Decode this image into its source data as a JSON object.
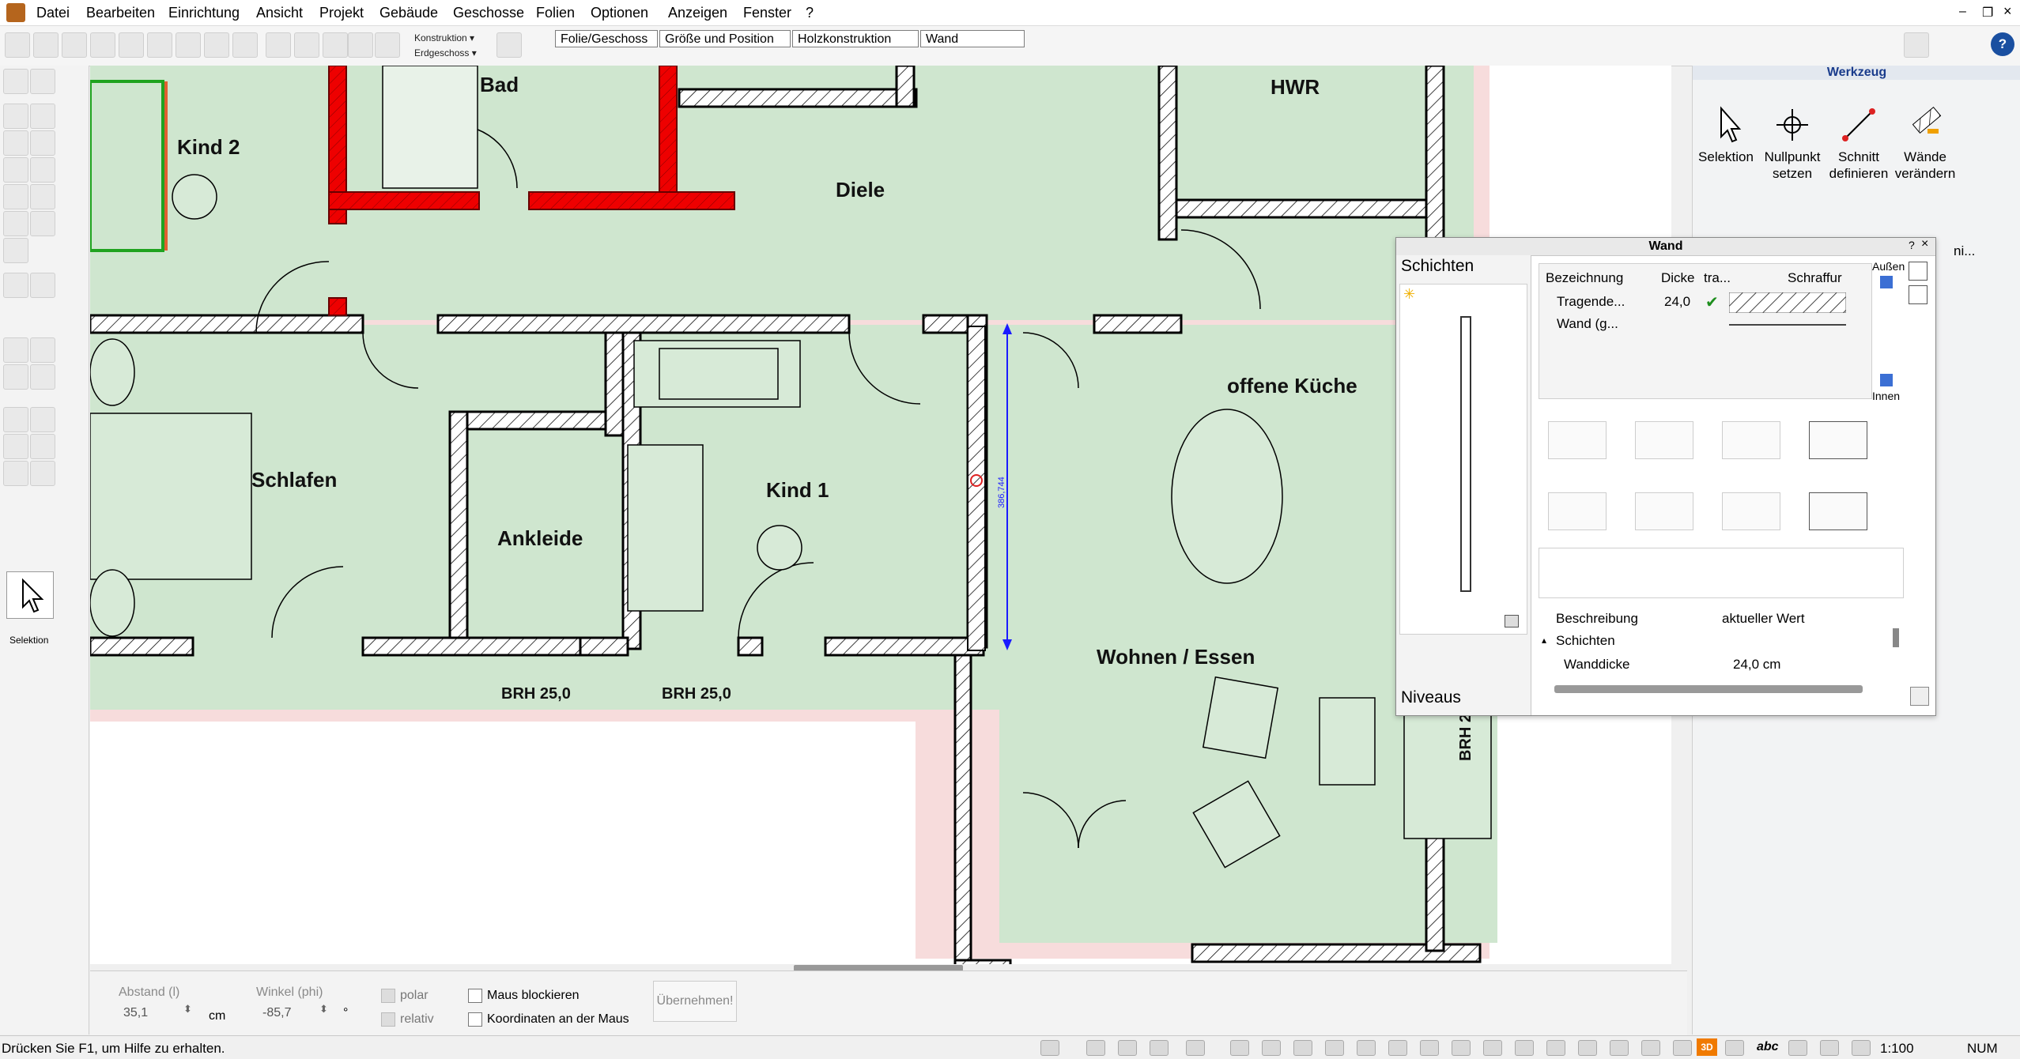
{
  "menu": [
    "Datei",
    "Bearbeiten",
    "Einrichtung",
    "Ansicht",
    "Projekt",
    "Gebäude",
    "Geschosse",
    "Folien",
    "Optionen",
    "Anzeigen",
    "Fenster",
    "?"
  ],
  "toolbar": {
    "konstruktion_label": "Konstruktion ▾",
    "erdgeschoss_label": "Erdgeschoss ▾",
    "fields": [
      "Folie/Geschoss",
      "Größe und Position",
      "Holzkonstruktion",
      "Wand"
    ]
  },
  "left_tools": {
    "selection_label": "Selektion"
  },
  "plan": {
    "rooms": [
      "Bad",
      "Kind 2",
      "Diele",
      "HWR",
      "offene Küche",
      "Schlafen",
      "Kind 1",
      "Ankleide",
      "Wohnen / Essen"
    ],
    "brh_labels": [
      "BRH 25,0",
      "BRH 25,0",
      "BRH 2"
    ],
    "dimension": "386,744"
  },
  "werkzeug": {
    "title": "Werkzeug",
    "tools": [
      {
        "line1": "Selektion",
        "line2": ""
      },
      {
        "line1": "Nullpunkt",
        "line2": "setzen"
      },
      {
        "line1": "Schnitt",
        "line2": "definieren"
      },
      {
        "line1": "Wände",
        "line2": "verändern"
      }
    ],
    "cut_label": "ni..."
  },
  "wand_dialog": {
    "title": "Wand",
    "tabs": {
      "schichten": "Schichten",
      "niveaus": "Niveaus"
    },
    "columns": [
      "Bezeichnung",
      "Dicke",
      "tra...",
      "Schraffur"
    ],
    "rows": [
      {
        "name": "Tragende...",
        "dicke": "24,0"
      },
      {
        "name": "Wand (g...",
        "dicke": ""
      }
    ],
    "side_labels": {
      "aussen": "Außen",
      "innen": "Innen"
    },
    "props_header": {
      "beschreibung": "Beschreibung",
      "wert": "aktueller Wert"
    },
    "props_group": "Schichten",
    "props_rows": [
      {
        "name": "Wanddicke",
        "value": "24,0 cm"
      }
    ]
  },
  "inputbar": {
    "abstand_label": "Abstand (l)",
    "abstand_value": "35,1",
    "abstand_unit": "cm",
    "winkel_label": "Winkel (phi)",
    "winkel_value": "-85,7",
    "winkel_unit": "°",
    "polar": "polar",
    "relativ": "relativ",
    "maus_blockieren": "Maus blockieren",
    "koordinaten": "Koordinaten an der Maus",
    "uebernehmen": "Übernehmen!"
  },
  "statusbar": {
    "hint": "Drücken Sie F1, um Hilfe zu erhalten.",
    "scale": "1:100",
    "num": "NUM",
    "view3d": "3D",
    "abc": "abc"
  }
}
